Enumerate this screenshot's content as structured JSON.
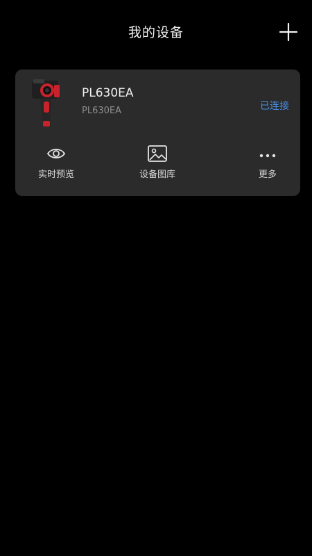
{
  "header": {
    "title": "我的设备"
  },
  "device": {
    "name": "PL630EA",
    "model": "PL630EA",
    "status": "已连接",
    "status_color": "#4a90e2"
  },
  "actions": [
    {
      "label": "实时预览",
      "icon": "eye-icon"
    },
    {
      "label": "设备图库",
      "icon": "image-gallery-icon"
    },
    {
      "label": "更多",
      "icon": "more-icon"
    }
  ]
}
